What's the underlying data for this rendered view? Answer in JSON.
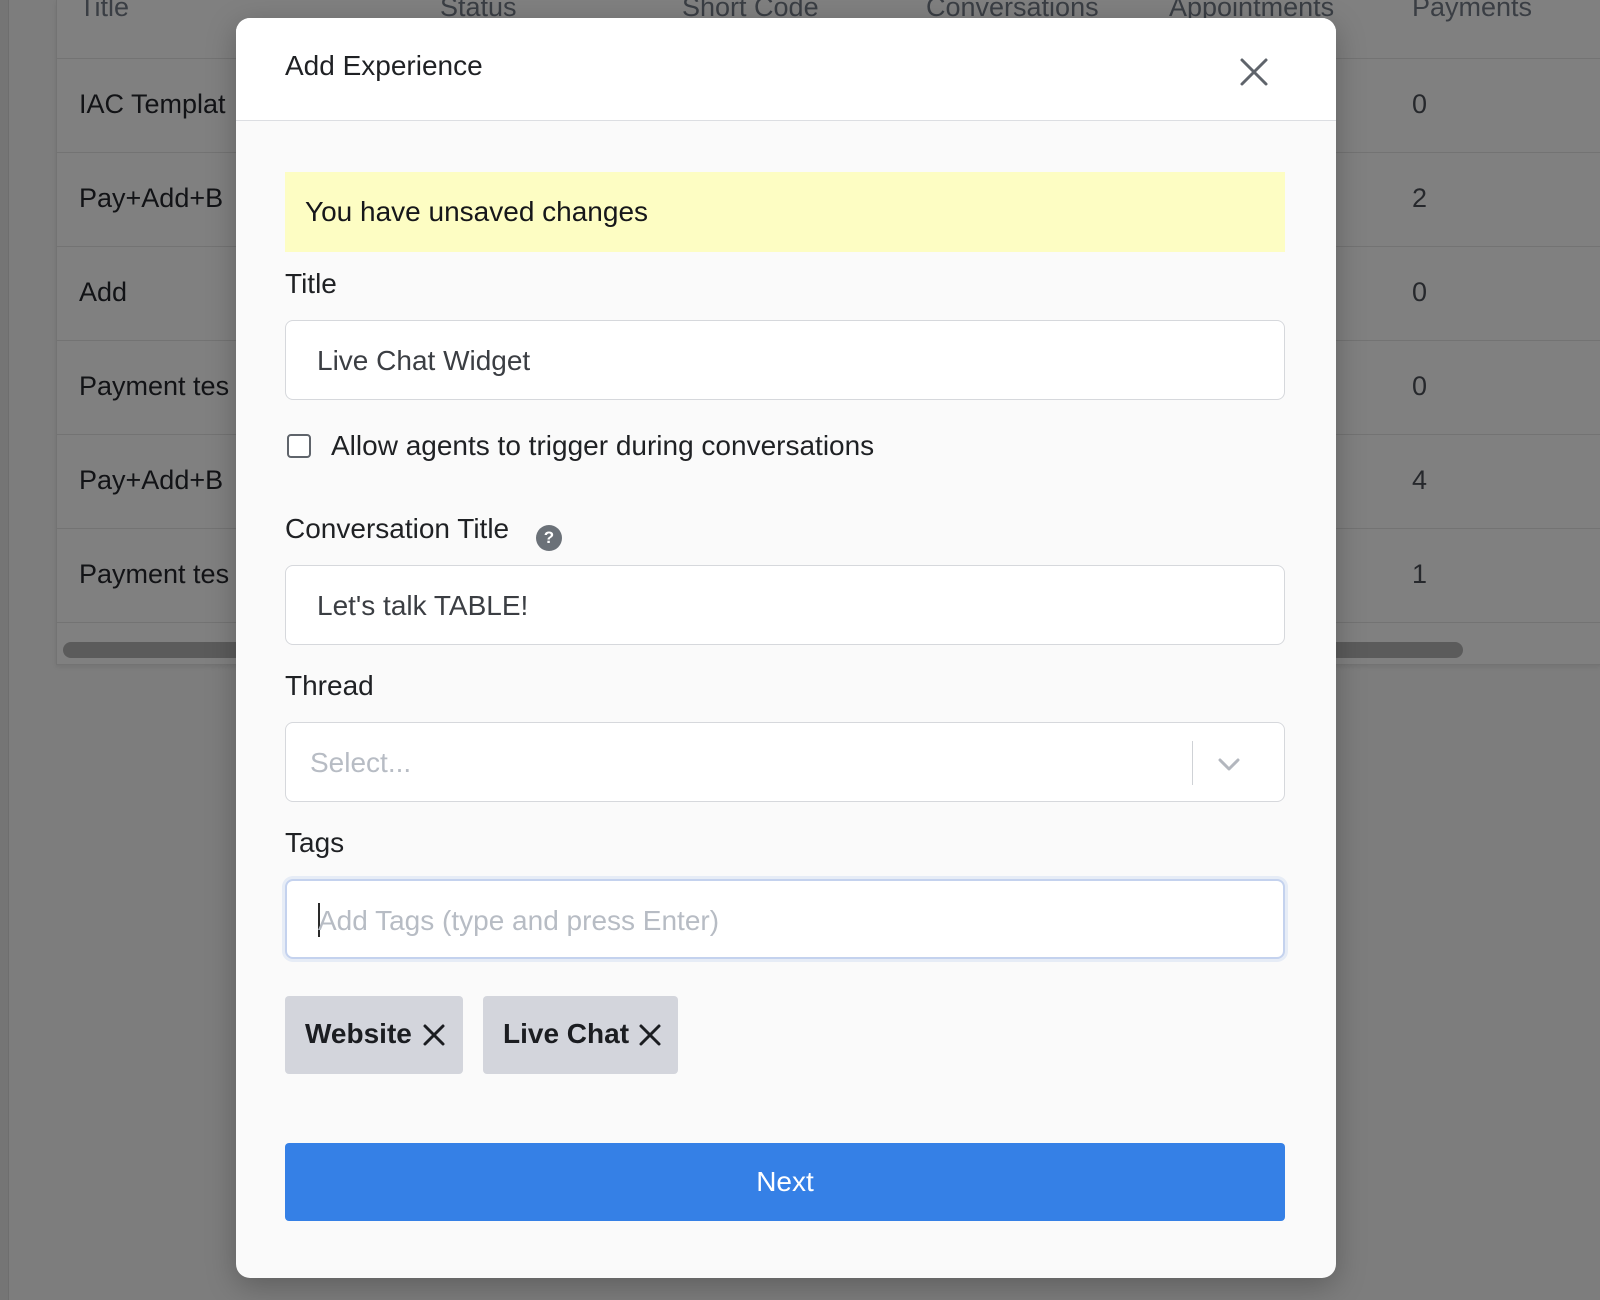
{
  "background_table": {
    "columns": [
      "Title",
      "Status",
      "Short Code",
      "Conversations",
      "Appointments",
      "Payments"
    ],
    "rows": [
      {
        "title": "IAC Templat",
        "payments": "0"
      },
      {
        "title": "Pay+Add+B",
        "payments": "2"
      },
      {
        "title": "Add",
        "payments": "0"
      },
      {
        "title": "Payment tes",
        "payments": "0"
      },
      {
        "title": "Pay+Add+B",
        "payments": "4"
      },
      {
        "title": "Payment tes",
        "payments": "1"
      }
    ]
  },
  "modal": {
    "title": "Add Experience",
    "close_icon": "close-icon",
    "notice": "You have unsaved changes",
    "fields": {
      "title_label": "Title",
      "title_value": "Live Chat Widget",
      "allow_agents_label": "Allow agents to trigger during conversations",
      "allow_agents_checked": false,
      "conversation_title_label": "Conversation Title",
      "help_icon": "question-circle-icon",
      "help_glyph": "?",
      "conversation_title_value": "Let's talk TABLE!",
      "thread_label": "Thread",
      "thread_placeholder": "Select...",
      "thread_chevron_icon": "chevron-down-icon",
      "tags_label": "Tags",
      "tags_placeholder": "Add Tags (type and press Enter)"
    },
    "tags": [
      {
        "label": "Website",
        "remove_icon": "close-icon"
      },
      {
        "label": "Live Chat",
        "remove_icon": "close-icon"
      }
    ],
    "next_label": "Next"
  },
  "colors": {
    "overlay": "#7d7d7d",
    "notice_bg": "#fdfdc3",
    "primary_button": "#3580e6",
    "tag_bg": "#d3d5dc"
  }
}
